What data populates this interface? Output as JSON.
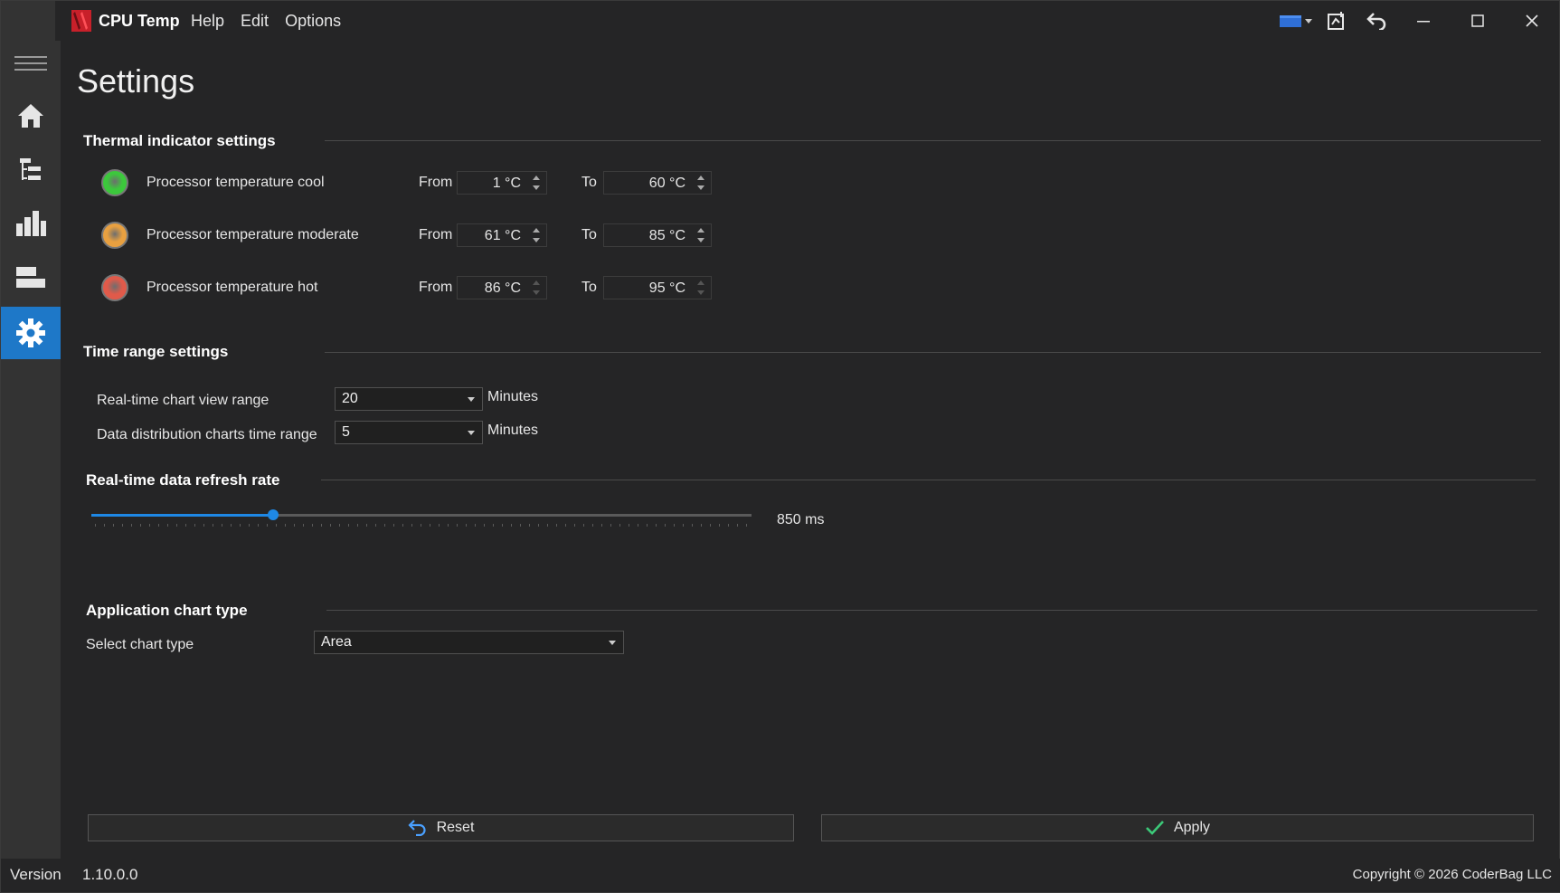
{
  "app": {
    "title": "CPU Temp",
    "menu": [
      "Help",
      "Edit",
      "Options"
    ]
  },
  "nav": {
    "items": [
      "menu-icon",
      "home-icon",
      "tree-icon",
      "bar-chart-icon",
      "layout-icon",
      "gear-icon"
    ],
    "active": "gear-icon"
  },
  "page": {
    "title": "Settings"
  },
  "thermal": {
    "title": "Thermal indicator settings",
    "from_label": "From",
    "to_label": "To",
    "rows": [
      {
        "label": "Processor temperature cool",
        "color": "#3cc83c",
        "from": "1 °C",
        "to": "60 °C"
      },
      {
        "label": "Processor temperature moderate",
        "color": "#e8a040",
        "from": "61 °C",
        "to": "85 °C"
      },
      {
        "label": "Processor temperature hot",
        "color": "#e05a4a",
        "from": "86 °C",
        "to": "95 °C"
      }
    ]
  },
  "time_range": {
    "title": "Time range settings",
    "realtime_label": "Real-time chart view range",
    "realtime_value": "20",
    "realtime_unit": "Minutes",
    "distribution_label": "Data distribution charts time range",
    "distribution_value": "5",
    "distribution_unit": "Minutes"
  },
  "refresh": {
    "title": "Real-time data refresh rate",
    "value_label": "850 ms",
    "fraction": 0.275
  },
  "chart_type": {
    "title": "Application chart type",
    "label": "Select chart type",
    "value": "Area"
  },
  "buttons": {
    "reset": "Reset",
    "apply": "Apply"
  },
  "status": {
    "version_label": "Version",
    "version": "1.10.0.0",
    "copyright": "Copyright © 2026 CoderBag LLC"
  }
}
